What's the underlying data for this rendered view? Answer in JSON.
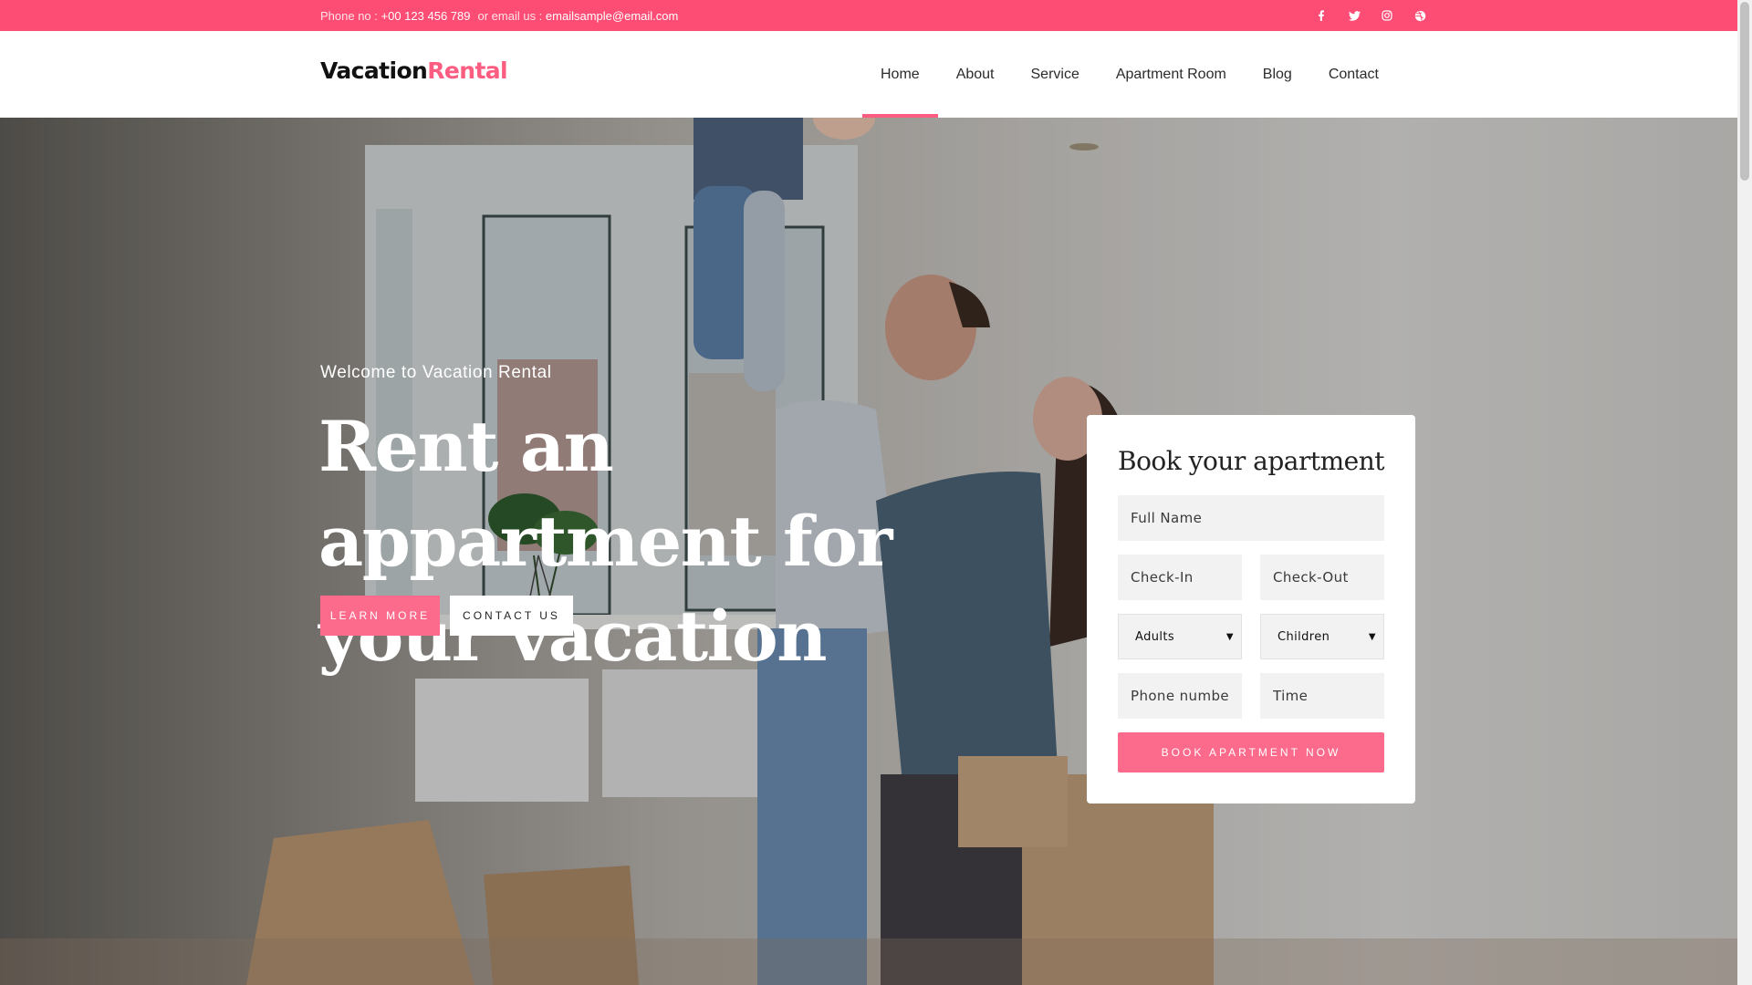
{
  "topbar": {
    "phone_label": "Phone no :",
    "phone_value": "+00 123 456 789",
    "email_label": "or email us :",
    "email_value": "emailsample@email.com",
    "social": [
      "facebook-icon",
      "twitter-icon",
      "instagram-icon",
      "dribbble-icon"
    ],
    "bg_color": "#fd4d74"
  },
  "logo": {
    "part1": "Vacation",
    "part2": "Rental",
    "accent_color": "#fd5d80"
  },
  "nav": {
    "items": [
      "Home",
      "About",
      "Service",
      "Apartment Room",
      "Blog",
      "Contact"
    ],
    "active": "Home"
  },
  "hero": {
    "welcome": "Welcome to Vacation Rental",
    "headline": "Rent an appartment for your vacation",
    "learn_more": "LEARN MORE",
    "contact_us": "CONTACT US"
  },
  "booking": {
    "title": "Book your apartment",
    "full_name": "Full Name",
    "check_in": "Check-In",
    "check_out": "Check-Out",
    "adults": "Adults",
    "children": "Children",
    "phone": "Phone number",
    "time": "Time",
    "submit": "BOOK APARTMENT NOW"
  }
}
